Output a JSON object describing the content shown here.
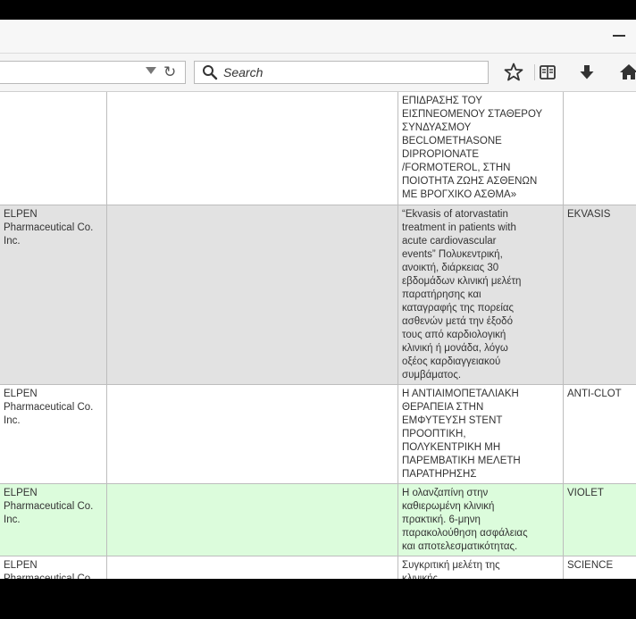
{
  "browser": {
    "search_placeholder": "Search"
  },
  "icons": {
    "bookmark_star": "star-icon",
    "reading_list": "reading-list-icon",
    "downloads": "download-arrow-icon",
    "home": "home-icon"
  },
  "colors": {
    "row_grey": "#e2e2e2",
    "row_green": "#dcfcdc",
    "row_white": "#ffffff"
  },
  "table": {
    "rows": [
      {
        "sponsor": "",
        "blank": "",
        "title": "ΕΠΙΔΡΑΣΗΣ ΤΟΥ\nΕΙΣΠΝΕΟΜΕΝΟΥ ΣΤΑΘΕΡΟΥ\nΣΥΝΔΥΑΣΜΟΥ\nBECLOMETHASONE\nDIPROPIONATE\n/FORMOTEROL, ΣΤΗΝ\nΠΟΙΟΤΗΤΑ ΖΩΗΣ ΑΣΘΕΝΩΝ\nΜΕ ΒΡΟΓΧΙΚΟ ΑΣΘΜΑ»",
        "code": ""
      },
      {
        "sponsor": "ELPEN\nPharmaceutical Co.\nInc.",
        "blank": "",
        "title": "“Ekvasis of atorvastatin\ntreatment in patients with\nacute cardiovascular\nevents” Πολυκεντρική,\nανοικτή, διάρκειας 30\nεβδομάδων κλινική μελέτη\nπαρατήρησης και\nκαταγραφής της πορείας\nασθενών μετά την έξοδό\nτους από καρδιολογική\nκλινική ή μονάδα, λόγω\nοξέος καρδιαγγειακού\nσυμβάματος.",
        "code": "EKVASIS"
      },
      {
        "sponsor": "ELPEN\nPharmaceutical Co.\nInc.",
        "blank": "",
        "title": "Η ΑΝΤΙΑΙΜΟΠΕΤΑΛΙΑΚΗ\nΘΕΡΑΠΕΙΑ ΣΤΗΝ\nΕΜΦΥΤΕΥΣΗ STENT\nΠΡΟΟΠΤΙΚΗ,\nΠΟΛΥΚΕΝΤΡΙΚΗ ΜΗ\nΠΑΡΕΜΒΑΤΙΚΗ ΜΕΛΕΤΗ\nΠΑΡΑΤΗΡΗΣΗΣ",
        "code": "ANTI-CLOT"
      },
      {
        "sponsor": "ELPEN\nPharmaceutical Co.\nInc.",
        "blank": "",
        "title": "Η ολανζαπίνη στην\nκαθιερωμένη κλινική\nπρακτική. 6-μηνη\nπαρακολούθηση ασφάλειας\nκαι αποτελεσματικότητας.",
        "code": "VIOLET"
      },
      {
        "sponsor": "ELPEN\nPharmaceutical Co.",
        "blank": "",
        "title": "Συγκριτική μελέτη της\nκλινικής",
        "code": "SCIENCE"
      }
    ]
  }
}
